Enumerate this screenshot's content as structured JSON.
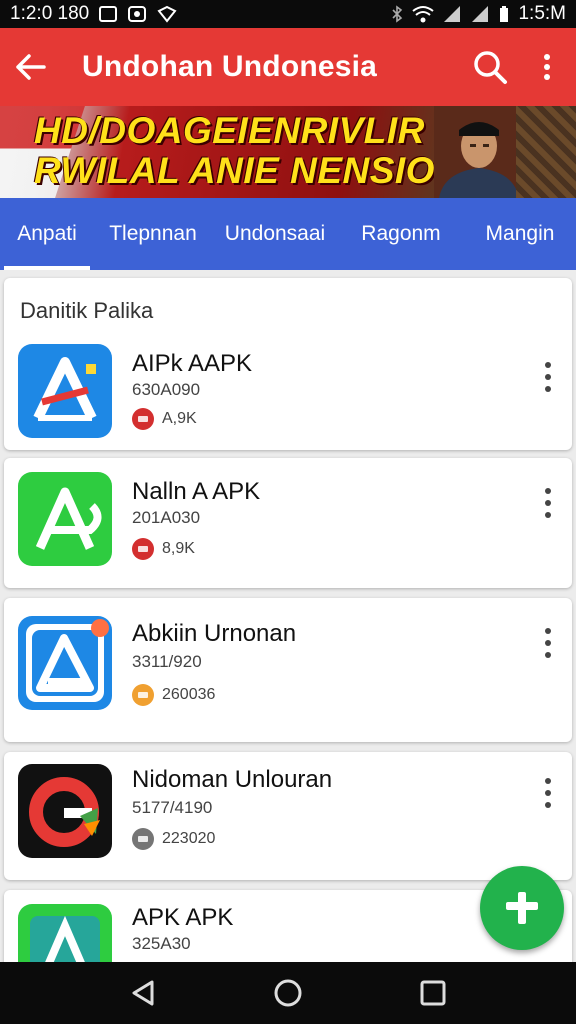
{
  "status_bar": {
    "time_left": "1:2:0 180",
    "time_right": "1:5:M"
  },
  "app_bar": {
    "title": "Undohan Undonesia",
    "back_icon": "back-arrow-icon",
    "search_icon": "search-icon",
    "more_icon": "more-vert-icon",
    "color": "#e53935"
  },
  "banner": {
    "line1": "HD/DOAGEIENRIVLIR",
    "line2": "RWILAL ANIE NENSIO?"
  },
  "tabs": [
    {
      "label": "Anpati",
      "active": true
    },
    {
      "label": "Tlepnnan",
      "active": false
    },
    {
      "label": "Undonsaai",
      "active": false
    },
    {
      "label": "Ragonm",
      "active": false
    },
    {
      "label": "Mangin",
      "active": false
    }
  ],
  "section": {
    "title": "Danitik Palika"
  },
  "apps": [
    {
      "name": "AIPk AAPK",
      "sub": "630A090",
      "meta": "A,9K",
      "meta_color": "#d32f2f",
      "icon_color": "#1e88e5"
    },
    {
      "name": "Nalln A APK",
      "sub": "201A030",
      "meta": "8,9K",
      "meta_color": "#d32f2f",
      "icon_color": "#2ecc40"
    },
    {
      "name": "Abkiin Urnonan",
      "sub": "3311/920",
      "meta": "260036",
      "meta_color": "#f0a030",
      "icon_color": "#1e88e5"
    },
    {
      "name": "Nidoman Unlouran",
      "sub": "5177/4190",
      "meta": "223020",
      "meta_color": "#757575",
      "icon_color": "#111111"
    },
    {
      "name": "APK APK",
      "sub": "325A30",
      "icon_color": "#2ecc40"
    }
  ],
  "fab": {
    "icon": "plus-icon",
    "color": "#22b24c"
  },
  "nav_bar": {
    "back": "nav-back-icon",
    "home": "nav-home-icon",
    "recents": "nav-recents-icon"
  }
}
